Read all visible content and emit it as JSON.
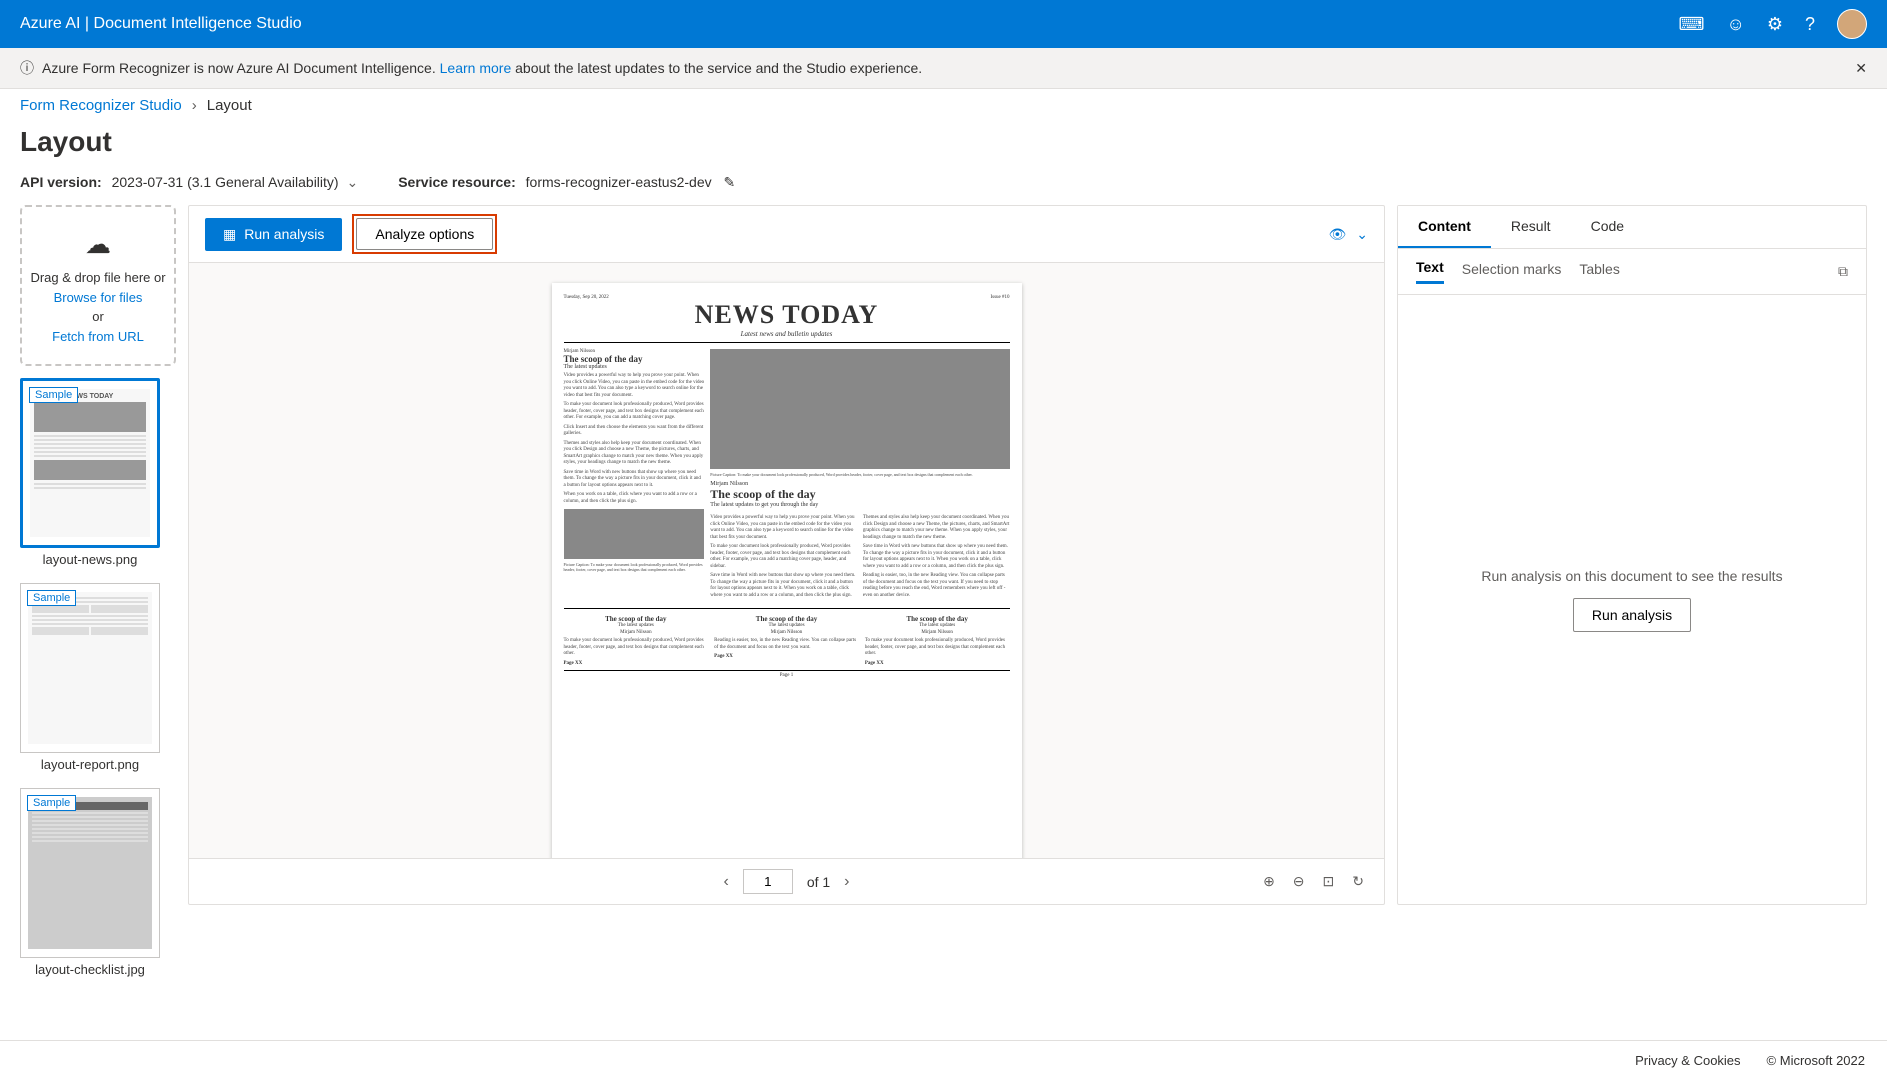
{
  "header": {
    "title": "Azure AI | Document Intelligence Studio"
  },
  "banner": {
    "pre": "Azure Form Recognizer is now Azure AI Document Intelligence.",
    "link": "Learn more",
    "post": "about the latest updates to the service and the Studio experience."
  },
  "breadcrumb": {
    "root": "Form Recognizer Studio",
    "current": "Layout"
  },
  "page_title": "Layout",
  "api": {
    "label": "API version:",
    "value": "2023-07-31 (3.1 General Availability)"
  },
  "service": {
    "label": "Service resource:",
    "value": "forms-recognizer-eastus2-dev"
  },
  "dropzone": {
    "line1": "Drag & drop file here or",
    "browse": "Browse for files",
    "or": "or",
    "fetch": "Fetch from URL"
  },
  "thumbs": [
    {
      "name": "layout-news.png",
      "sample": "Sample",
      "selected": true,
      "title": "NEWS TODAY"
    },
    {
      "name": "layout-report.png",
      "sample": "Sample",
      "selected": false,
      "title": ""
    },
    {
      "name": "layout-checklist.jpg",
      "sample": "Sample",
      "selected": false,
      "title": ""
    }
  ],
  "center_toolbar": {
    "run": "Run analysis",
    "options": "Analyze options"
  },
  "doc": {
    "masthead_title": "NEWS TODAY",
    "masthead_sub": "Latest news and bulletin updates",
    "date": "Tuesday, Sep 20, 2022",
    "issue": "Issue #10",
    "author": "Mirjam Nilsson",
    "heading": "The scoop of the day",
    "subheading": "The latest updates",
    "subheading2": "The latest updates to get you through the day",
    "page_ref": "Page XX",
    "page_num": "Page 1",
    "caption": "Picture Caption: To make your document look professionally produced, Word provides header, footer, cover page, and text box designs that complement each other.",
    "para1": "Video provides a powerful way to help you prove your point. When you click Online Video, you can paste in the embed code for the video you want to add. You can also type a keyword to search online for the video that best fits your document.",
    "para2": "To make your document look professionally produced, Word provides header, footer, cover page, and text box designs that complement each other. For example, you can add a matching cover page.",
    "para3": "Click Insert and then choose the elements you want from the different galleries.",
    "para4": "Themes and styles also help keep your document coordinated. When you click Design and choose a new Theme, the pictures, charts, and SmartArt graphics change to match your new theme. When you apply styles, your headings change to match the new theme.",
    "para5": "Save time in Word with new buttons that show up where you need them. To change the way a picture fits in your document, click it and a button for layout options appears next to it.",
    "para6": "When you work on a table, click where you want to add a row or a column, and then click the plus sign.",
    "para7": "To make your document look professionally produced, Word provides header, footer, cover page, and text box designs that complement each other. For example, you can add a matching cover page, header, and sidebar.",
    "para8": "Save time in Word with new buttons that show up where you need them. To change the way a picture fits in your document, click it and a button for layout options appears next to it. When you work on a table, click where you want to add a row or a column, and then click the plus sign.",
    "para9": "Reading is easier, too, in the new Reading view. You can collapse parts of the document and focus on the text you want. If you need to stop reading before you reach the end, Word remembers where you left off - even on another device.",
    "bot_para": "To make your document look professionally produced, Word provides header, footer, cover page, and text box designs that complement each other.",
    "bot_para2": "Reading is easier, too, in the new Reading view. You can collapse parts of the document and focus on the text you want."
  },
  "pager": {
    "current": "1",
    "total": "of 1"
  },
  "rightpanel": {
    "tabs": [
      "Content",
      "Result",
      "Code"
    ],
    "subtabs": [
      "Text",
      "Selection marks",
      "Tables"
    ],
    "empty_msg": "Run analysis on this document to see the results",
    "run_btn": "Run analysis"
  },
  "footer": {
    "privacy": "Privacy & Cookies",
    "copyright": "© Microsoft 2022"
  }
}
